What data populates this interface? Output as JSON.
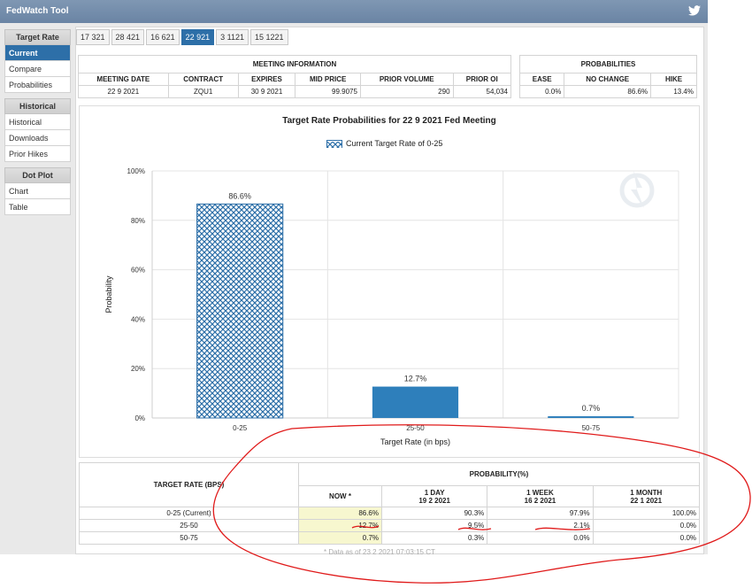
{
  "window": {
    "title": "FedWatch Tool"
  },
  "sidebar": {
    "sections": [
      {
        "header": "Target Rate",
        "items": [
          {
            "label": "Current",
            "active": true
          },
          {
            "label": "Compare"
          },
          {
            "label": "Probabilities"
          }
        ]
      },
      {
        "header": "Historical",
        "items": [
          {
            "label": "Historical"
          },
          {
            "label": "Downloads"
          },
          {
            "label": "Prior Hikes"
          }
        ]
      },
      {
        "header": "Dot Plot",
        "items": [
          {
            "label": "Chart"
          },
          {
            "label": "Table"
          }
        ]
      }
    ]
  },
  "tabs": [
    {
      "label": "17 321"
    },
    {
      "label": "28 421"
    },
    {
      "label": "16 621"
    },
    {
      "label": "22 921",
      "active": true
    },
    {
      "label": "3 1121"
    },
    {
      "label": "15 1221"
    }
  ],
  "meeting_info": {
    "header": "MEETING INFORMATION",
    "columns": [
      "MEETING DATE",
      "CONTRACT",
      "EXPIRES",
      "MID PRICE",
      "PRIOR VOLUME",
      "PRIOR OI"
    ],
    "values": [
      "22 9 2021",
      "ZQU1",
      "30 9 2021",
      "99.9075",
      "290",
      "54,034"
    ]
  },
  "probabilities": {
    "header": "PROBABILITIES",
    "columns": [
      "EASE",
      "NO CHANGE",
      "HIKE"
    ],
    "values": [
      "0.0%",
      "86.6%",
      "13.4%"
    ]
  },
  "chart_data": {
    "type": "bar",
    "title": "Target Rate Probabilities for 22 9 2021 Fed Meeting",
    "legend": "Current Target Rate of 0-25",
    "categories": [
      "0-25",
      "25-50",
      "50-75"
    ],
    "values": [
      86.6,
      12.7,
      0.7
    ],
    "value_labels": [
      "86.6%",
      "12.7%",
      "0.7%"
    ],
    "ylabel": "Probability",
    "xlabel": "Target Rate (in bps)",
    "ylim": [
      0,
      100
    ],
    "yticks": [
      "0%",
      "20%",
      "40%",
      "60%",
      "80%",
      "100%"
    ],
    "grid": true,
    "colors": {
      "current": "#2d6fa8",
      "other": "#2e7fbb"
    }
  },
  "prob_table": {
    "row_header": "TARGET RATE (BPS)",
    "group_header": "PROBABILITY(%)",
    "columns": [
      {
        "name": "NOW *",
        "date": ""
      },
      {
        "name": "1 DAY",
        "date": "19 2 2021"
      },
      {
        "name": "1 WEEK",
        "date": "16 2 2021"
      },
      {
        "name": "1 MONTH",
        "date": "22 1 2021"
      }
    ],
    "rows": [
      {
        "rate": "0-25 (Current)",
        "values": [
          "86.6%",
          "90.3%",
          "97.9%",
          "100.0%"
        ]
      },
      {
        "rate": "25-50",
        "values": [
          "12.7%",
          "9.5%",
          "2.1%",
          "0.0%"
        ]
      },
      {
        "rate": "50-75",
        "values": [
          "0.7%",
          "0.3%",
          "0.0%",
          "0.0%"
        ]
      }
    ],
    "footnote": "* Data as of 23 2 2021 07:03:15 CT"
  },
  "annotation": {
    "color": "#e01a1a"
  }
}
